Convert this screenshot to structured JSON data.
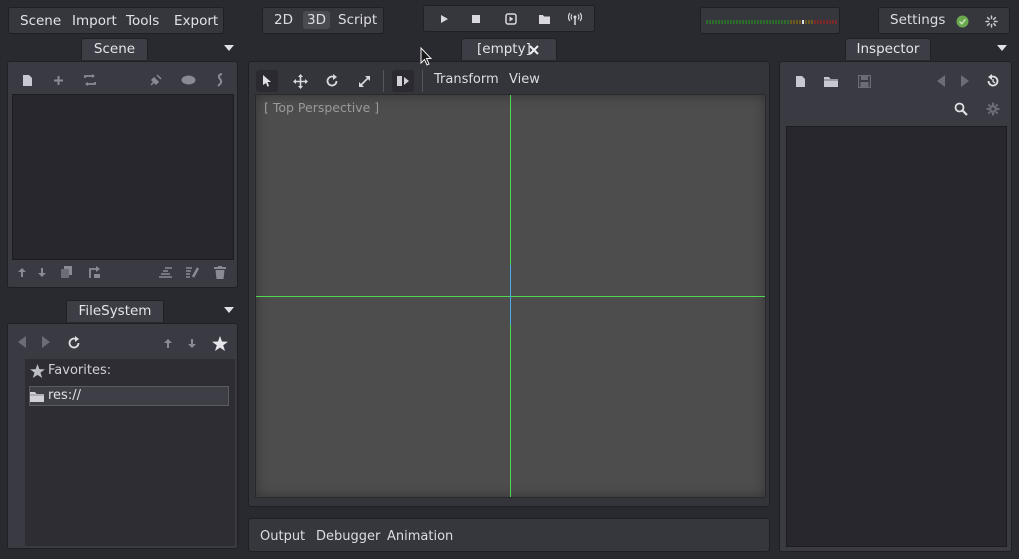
{
  "menu": {
    "scene": "Scene",
    "import": "Import",
    "tools": "Tools",
    "export": "Export"
  },
  "modes": {
    "two_d": "2D",
    "three_d": "3D",
    "script": "Script",
    "active": "3D"
  },
  "play_controls": [
    "play-icon",
    "stop-icon",
    "play-scene-icon",
    "play-custom-icon",
    "remote-debug-icon"
  ],
  "settings": {
    "label": "Settings"
  },
  "scene_dock": {
    "tab": "Scene"
  },
  "filesystem_dock": {
    "tab": "FileSystem",
    "favorites_label": "Favorites:",
    "path": "res://"
  },
  "editor_tab": {
    "label": "[empty]"
  },
  "viewport_toolbar": {
    "transform": "Transform",
    "view": "View"
  },
  "viewport": {
    "label": "[ Top Perspective ]",
    "axis_colors": {
      "x": "#4ed84e",
      "y": "#4ed84e",
      "z": "#4aa8e8"
    }
  },
  "bottom_panel": {
    "output": "Output",
    "debugger": "Debugger",
    "animation": "Animation"
  },
  "inspector": {
    "tab": "Inspector"
  },
  "colors": {
    "bg": "#292930",
    "panel": "#3a3a42",
    "viewport": "#4d4d4d",
    "accent_green": "#4ed84e"
  }
}
